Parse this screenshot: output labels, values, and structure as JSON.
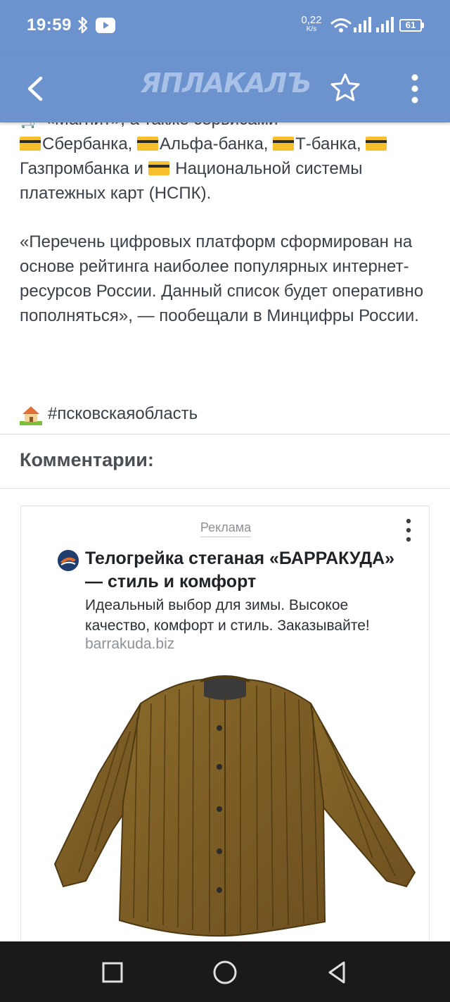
{
  "status_bar": {
    "time": "19:59",
    "net_speed_value": "0,22",
    "net_speed_unit": "K/s",
    "battery": "61",
    "icons": [
      "bluetooth-icon",
      "youtube-icon",
      "wifi-icon",
      "signal-icon",
      "signal-icon",
      "battery-icon"
    ]
  },
  "app_bar": {
    "logo": "ЯПЛАКАЛЪ",
    "icons": [
      "back-arrow-icon",
      "star-icon",
      "more-vertical-icon"
    ]
  },
  "article": {
    "para1_line0": "🛒 «Магнит», а также сервисами",
    "para1_a": "Сбербанка, ",
    "para1_b": "Альфа-банка, ",
    "para1_c": "Т-банка, ",
    "para1_d": "Газпромбанка и ",
    "para1_e": " Национальной системы платежных карт (НСПК).",
    "para2": "«Перечень цифровых платформ сформирован на основе рейтинга наиболее популярных интернет-ресурсов России. Данный список будет оперативно пополняться», — пообещали в Минцифры России.",
    "hashtag": "#псковскаяобласть"
  },
  "comments": {
    "title": "Комментарии:"
  },
  "ad": {
    "label": "Реклама",
    "title": "Телогрейка стеганая «БАРРАКУДА» — стиль и комфорт",
    "description": "Идеальный выбор для зимы. Высокое качество, комфорт и стиль. Заказывайте!",
    "domain": "barrakuda.biz",
    "image_alt": "quilted jacket",
    "jacket_color": "#7a5a22"
  },
  "colors": {
    "header_blue": "#6d93cf",
    "text": "#3a4049",
    "nav_bar": "#1a1a1a"
  }
}
